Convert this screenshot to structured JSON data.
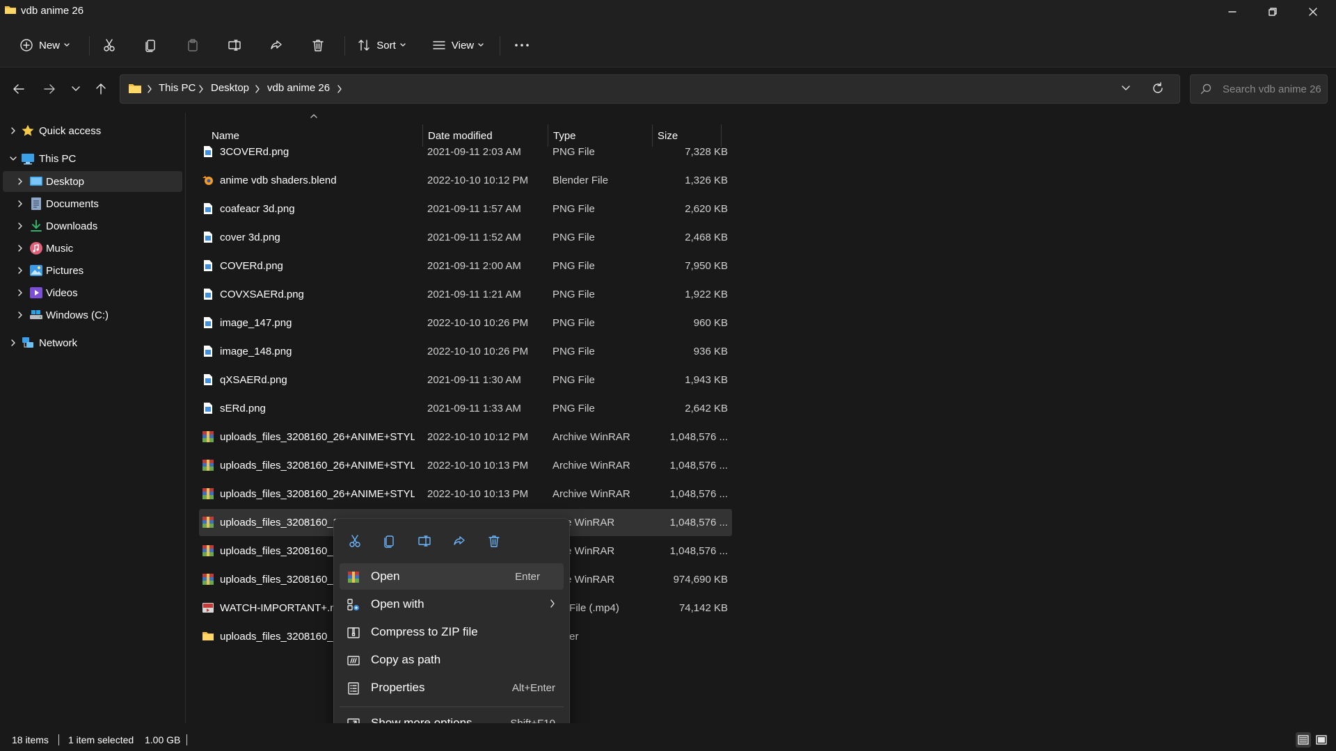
{
  "window": {
    "title": "vdb anime 26",
    "folder_color": "#f4c242"
  },
  "toolbar": {
    "new_label": "New",
    "sort_label": "Sort",
    "view_label": "View",
    "icons": [
      "plus-circle-icon",
      "cut-icon",
      "copy-icon",
      "paste-icon",
      "rename-icon",
      "share-icon",
      "delete-icon",
      "sort-icon",
      "view-icon",
      "more-icon"
    ]
  },
  "address": {
    "crumbs": [
      "This PC",
      "Desktop",
      "vdb anime 26"
    ]
  },
  "search": {
    "placeholder": "Search vdb anime 26"
  },
  "sidebar": {
    "items": [
      {
        "label": "Quick access",
        "icon": "star-icon"
      },
      {
        "label": "This PC",
        "icon": "computer-icon"
      },
      {
        "label": "Desktop",
        "icon": "desktop-icon"
      },
      {
        "label": "Documents",
        "icon": "documents-icon"
      },
      {
        "label": "Downloads",
        "icon": "downloads-icon"
      },
      {
        "label": "Music",
        "icon": "music-icon"
      },
      {
        "label": "Pictures",
        "icon": "pictures-icon"
      },
      {
        "label": "Videos",
        "icon": "videos-icon"
      },
      {
        "label": "Windows (C:)",
        "icon": "drive-icon"
      },
      {
        "label": "Network",
        "icon": "network-icon"
      }
    ]
  },
  "columns": {
    "name": "Name",
    "date": "Date modified",
    "type": "Type",
    "size": "Size"
  },
  "files": [
    {
      "name": "3COVERd.png",
      "date": "2021-09-11 2:03 AM",
      "type": "PNG File",
      "size": "7,328 KB",
      "kind": "png"
    },
    {
      "name": "anime vdb shaders.blend",
      "date": "2022-10-10 10:12 PM",
      "type": "Blender File",
      "size": "1,326 KB",
      "kind": "blend"
    },
    {
      "name": "coafeacr 3d.png",
      "date": "2021-09-11 1:57 AM",
      "type": "PNG File",
      "size": "2,620 KB",
      "kind": "png"
    },
    {
      "name": "cover 3d.png",
      "date": "2021-09-11 1:52 AM",
      "type": "PNG File",
      "size": "2,468 KB",
      "kind": "png"
    },
    {
      "name": "COVERd.png",
      "date": "2021-09-11 2:00 AM",
      "type": "PNG File",
      "size": "7,950 KB",
      "kind": "png"
    },
    {
      "name": "COVXSAERd.png",
      "date": "2021-09-11 1:21 AM",
      "type": "PNG File",
      "size": "1,922 KB",
      "kind": "png"
    },
    {
      "name": "image_147.png",
      "date": "2022-10-10 10:26 PM",
      "type": "PNG File",
      "size": "960 KB",
      "kind": "png"
    },
    {
      "name": "image_148.png",
      "date": "2022-10-10 10:26 PM",
      "type": "PNG File",
      "size": "936 KB",
      "kind": "png"
    },
    {
      "name": "qXSAERd.png",
      "date": "2021-09-11 1:30 AM",
      "type": "PNG File",
      "size": "1,943 KB",
      "kind": "png"
    },
    {
      "name": "sERd.png",
      "date": "2021-09-11 1:33 AM",
      "type": "PNG File",
      "size": "2,642 KB",
      "kind": "png"
    },
    {
      "name": "uploads_files_3208160_26+ANIME+STYL...",
      "date": "2022-10-10 10:12 PM",
      "type": "Archive WinRAR",
      "size": "1,048,576 ...",
      "kind": "rar"
    },
    {
      "name": "uploads_files_3208160_26+ANIME+STYL...",
      "date": "2022-10-10 10:13 PM",
      "type": "Archive WinRAR",
      "size": "1,048,576 ...",
      "kind": "rar"
    },
    {
      "name": "uploads_files_3208160_26+ANIME+STYL...",
      "date": "2022-10-10 10:13 PM",
      "type": "Archive WinRAR",
      "size": "1,048,576 ...",
      "kind": "rar"
    },
    {
      "name": "uploads_files_3208160_2",
      "date": "",
      "type": "hive WinRAR",
      "size": "1,048,576 ...",
      "kind": "rar"
    },
    {
      "name": "uploads_files_3208160_2",
      "date": "",
      "type": "hive WinRAR",
      "size": "1,048,576 ...",
      "kind": "rar"
    },
    {
      "name": "uploads_files_3208160_2",
      "date": "",
      "type": "hive WinRAR",
      "size": "974,690 KB",
      "kind": "rar"
    },
    {
      "name": "WATCH-IMPORTANT+.m",
      "date": "",
      "type": "dia File (.mp4)",
      "size": "74,142 KB",
      "kind": "mp4"
    },
    {
      "name": "uploads_files_3208160_2",
      "date": "",
      "type": "folder",
      "size": "",
      "kind": "folder"
    }
  ],
  "context_menu": {
    "quick_icons": [
      "cut-icon",
      "copy-icon",
      "rename-icon",
      "share-icon",
      "delete-icon"
    ],
    "items": [
      {
        "label": "Open",
        "shortcut": "Enter",
        "icon": "winrar-icon"
      },
      {
        "label": "Open with",
        "shortcut": "",
        "icon": "open-with-icon"
      },
      {
        "label": "Compress to ZIP file",
        "shortcut": "",
        "icon": "zip-icon"
      },
      {
        "label": "Copy as path",
        "shortcut": "",
        "icon": "copy-path-icon"
      },
      {
        "label": "Properties",
        "shortcut": "Alt+Enter",
        "icon": "properties-icon"
      },
      {
        "label": "Show more options",
        "shortcut": "Shift+F10",
        "icon": "more-options-icon"
      }
    ]
  },
  "status": {
    "count": "18 items",
    "selection": "1 item selected",
    "size": "1.00 GB"
  },
  "colors": {
    "png_blue": "#3f8fe0",
    "rar_red": "#c23b3b",
    "folder_yellow": "#f4c242",
    "blender_orange": "#f59a23"
  }
}
